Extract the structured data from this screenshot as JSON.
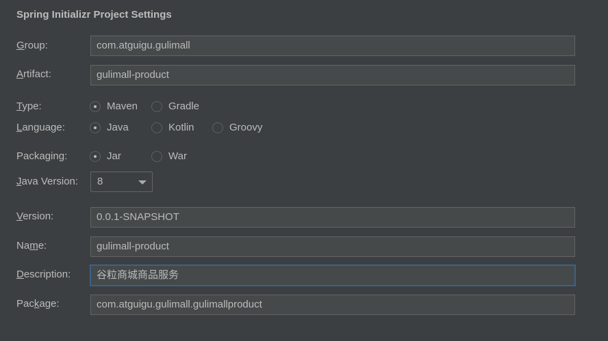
{
  "title": "Spring Initializr Project Settings",
  "labels": {
    "group": [
      "",
      "G",
      "roup:"
    ],
    "artifact": [
      "",
      "A",
      "rtifact:"
    ],
    "type": [
      "",
      "T",
      "ype:"
    ],
    "language": [
      "",
      "L",
      "anguage:"
    ],
    "packaging": [
      "Packa",
      "g",
      "ing:"
    ],
    "java_version": [
      "",
      "J",
      "ava Version:"
    ],
    "version": [
      "",
      "V",
      "ersion:"
    ],
    "name": [
      "Na",
      "m",
      "e:"
    ],
    "description": [
      "",
      "D",
      "escription:"
    ],
    "package": [
      "Pac",
      "k",
      "age:"
    ]
  },
  "fields": {
    "group": "com.atguigu.gulimall",
    "artifact": "gulimall-product",
    "version": "0.0.1-SNAPSHOT",
    "name": "gulimall-product",
    "description": "谷粒商城商品服务",
    "package": "com.atguigu.gulimall.gulimallproduct"
  },
  "type_options": [
    {
      "label": "Maven",
      "selected": true
    },
    {
      "label": "Gradle",
      "selected": false
    }
  ],
  "language_options": [
    {
      "label": "Java",
      "selected": true
    },
    {
      "label": "Kotlin",
      "selected": false
    },
    {
      "label": "Groovy",
      "selected": false
    }
  ],
  "packaging_options": [
    {
      "label": "Jar",
      "selected": true
    },
    {
      "label": "War",
      "selected": false
    }
  ],
  "java_version": "8",
  "colors": {
    "background": "#3c3f41",
    "field": "#45494a",
    "focus_border": "#3d6185"
  }
}
